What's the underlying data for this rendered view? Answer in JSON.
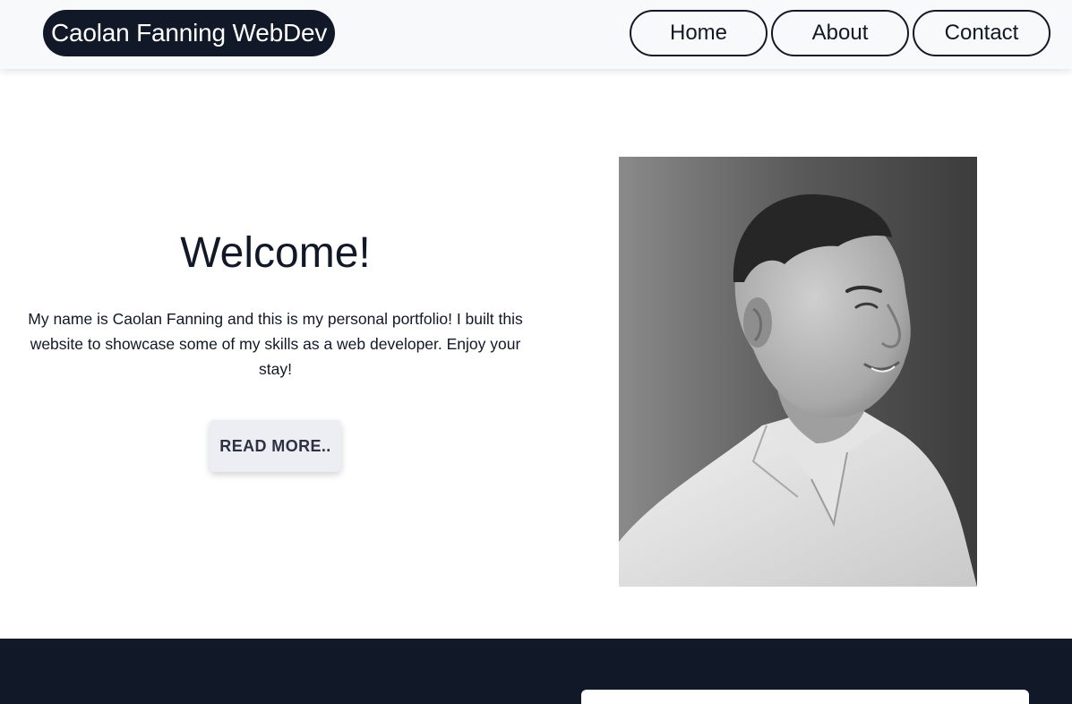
{
  "navbar": {
    "brand": "Caolan Fanning WebDev",
    "links": [
      {
        "label": "Home"
      },
      {
        "label": "About"
      },
      {
        "label": "Contact"
      }
    ]
  },
  "hero": {
    "heading": "Welcome!",
    "intro": "My name is Caolan Fanning and this is my personal portfolio! I built this website to showcase some of my skills as a web developer. Enjoy your stay!",
    "button_label": "READ MORE.."
  },
  "photo": {
    "style": "black-and-white portrait",
    "icon": "portrait-photo"
  },
  "colors": {
    "nav_background": "#f8f9fa",
    "dark": "#111827",
    "button_background": "#eceef4",
    "footer_background": "#111827"
  }
}
